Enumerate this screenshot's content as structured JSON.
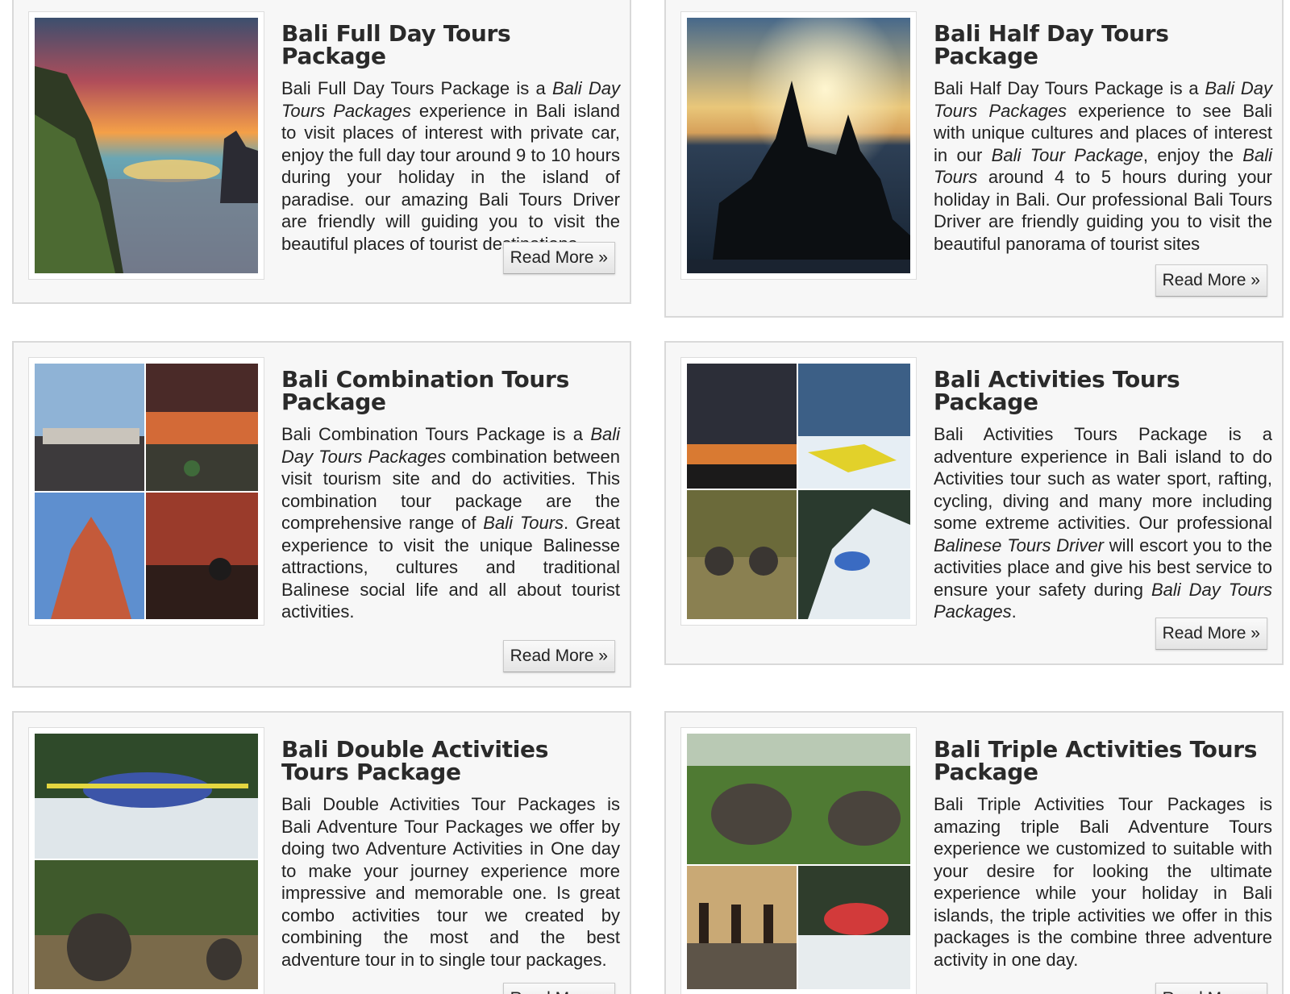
{
  "read_more_label": "Read More »",
  "cards": [
    {
      "title": "Bali Full Day Tours Package",
      "desc": [
        {
          "t": "Bali Full Day Tours Package is a "
        },
        {
          "t": "Bali Day Tours Packages",
          "i": true
        },
        {
          "t": " experience in Bali island to visit places of interest with private car, enjoy the full day tour around 9 to 10 hours during your holiday in the island of paradise. our amazing Bali Tours Driver are friendly will guiding you to visit the beautiful places of tourist destinations"
        }
      ]
    },
    {
      "title": "Bali Half Day Tours Package",
      "desc": [
        {
          "t": "Bali Half Day Tours Package is a "
        },
        {
          "t": "Bali Day Tours Packages",
          "i": true
        },
        {
          "t": " experience to see Bali with unique cultures and places of interest in our "
        },
        {
          "t": "Bali Tour Package",
          "i": true
        },
        {
          "t": ", enjoy the "
        },
        {
          "t": "Bali Tours",
          "i": true
        },
        {
          "t": " around 4 to 5 hours during your holiday in Bali. Our professional Bali Tours Driver are friendly guiding you to visit the beautiful panorama of tourist sites"
        }
      ]
    },
    {
      "title": "Bali Combination Tours Package",
      "desc": [
        {
          "t": "Bali Combination Tours Package is a "
        },
        {
          "t": "Bali Day Tours Packages",
          "i": true
        },
        {
          "t": " combination between visit tourism site and do activities. This combination tour package are the comprehensive range of "
        },
        {
          "t": "Bali Tours",
          "i": true
        },
        {
          "t": ". Great experience to visit the unique Balinesse attractions, cultures and traditional Balinese social life and all about tourist activities."
        }
      ]
    },
    {
      "title": "Bali Activities Tours Package",
      "desc": [
        {
          "t": "Bali Activities Tours Package is a adventure experience in Bali island to do Activities tour such as water sport, rafting, cycling, diving and many more including some extreme activities. Our professional "
        },
        {
          "t": "Balinese Tours Driver",
          "i": true
        },
        {
          "t": " will escort you to the activities place and give his best service to ensure your safety during "
        },
        {
          "t": "Bali Day Tours Packages",
          "i": true
        },
        {
          "t": "."
        }
      ]
    },
    {
      "title": "Bali Double Activities Tours Package",
      "desc": [
        {
          "t": "Bali Double Activities Tour Packages is Bali Adventure Tour Packages we offer by doing two Adventure Activities in One day to make your journey experience more impressive and memorable one. Is great combo activities tour we created by combining the most and the best adventure tour in to single tour packages."
        }
      ]
    },
    {
      "title": "Bali Triple Activities Tours Package",
      "desc": [
        {
          "t": "Bali Triple Activities Tour Packages is amazing triple Bali Adventure Tours experience we customized to suitable with your desire for looking the ultimate experience while your holiday in Bali islands, the triple activities we offer in this packages is the combine three adventure activity in one day."
        }
      ]
    }
  ]
}
